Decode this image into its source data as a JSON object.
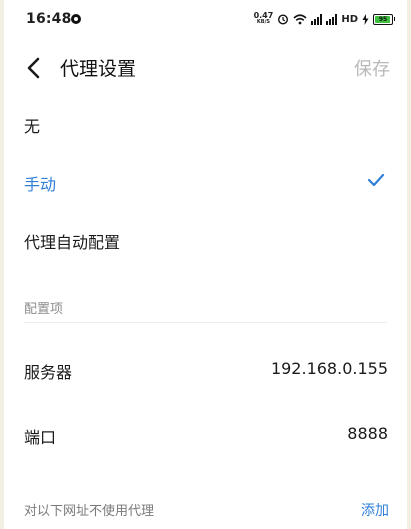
{
  "status_bar": {
    "time": "16:48",
    "speed_value": "0.47",
    "speed_unit": "KB/S",
    "signal_label": "HD",
    "battery_level": "95",
    "battery_color": "#3fbf3f"
  },
  "header": {
    "title": "代理设置",
    "save_label": "保存",
    "save_color": "#b9b9b9"
  },
  "proxy_options": [
    {
      "label": "无",
      "selected": false
    },
    {
      "label": "手动",
      "selected": true
    },
    {
      "label": "代理自动配置",
      "selected": false
    }
  ],
  "accent_color": "#2f7fd8",
  "config": {
    "section_label": "配置项",
    "server_label": "服务器",
    "server_value": "192.168.0.155",
    "port_label": "端口",
    "port_value": "8888",
    "bypass_label": "对以下网址不使用代理",
    "add_label": "添加"
  }
}
